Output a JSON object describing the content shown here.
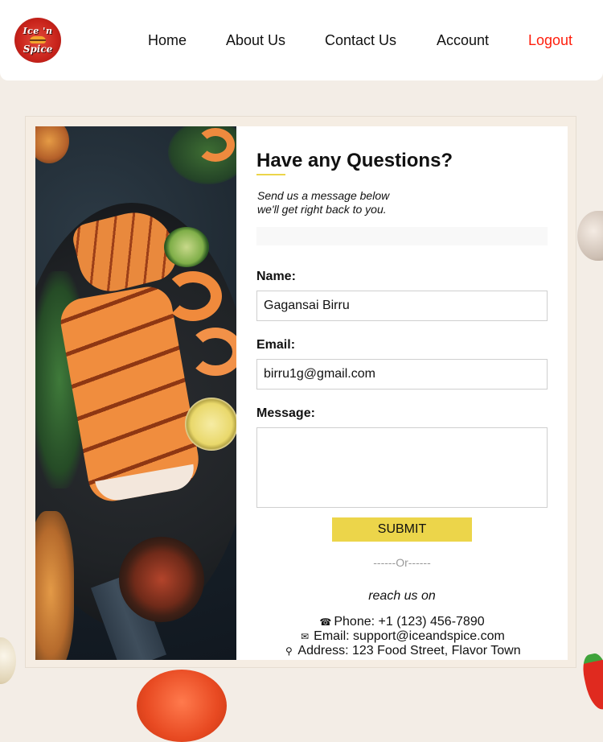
{
  "brand": {
    "logo_line1": "Ice 'n",
    "logo_line2": "Spice"
  },
  "nav": {
    "home": "Home",
    "about": "About Us",
    "contact": "Contact Us",
    "account": "Account",
    "logout": "Logout"
  },
  "form": {
    "title": "Have any Questions?",
    "subtitle_line1": "Send us a message below",
    "subtitle_line2": "we'll get right back to you.",
    "name_label": "Name:",
    "name_value": "Gagansai Birru",
    "email_label": "Email:",
    "email_value": "birru1g@gmail.com",
    "message_label": "Message:",
    "message_value": "",
    "submit_label": "SUBMIT",
    "divider": "------Or------",
    "reach_text": "reach us on"
  },
  "contact": {
    "phone": "Phone: +1 (123) 456-7890",
    "email": "Email: support@iceandspice.com",
    "address": "Address: 123 Food Street, Flavor Town",
    "phone_icon": "☎",
    "email_icon": "✉",
    "address_icon": "⚲"
  },
  "colors": {
    "accent": "#ecd54a",
    "logout": "#ff1e0c",
    "brand": "#c8231b",
    "background": "#f3ede6"
  }
}
